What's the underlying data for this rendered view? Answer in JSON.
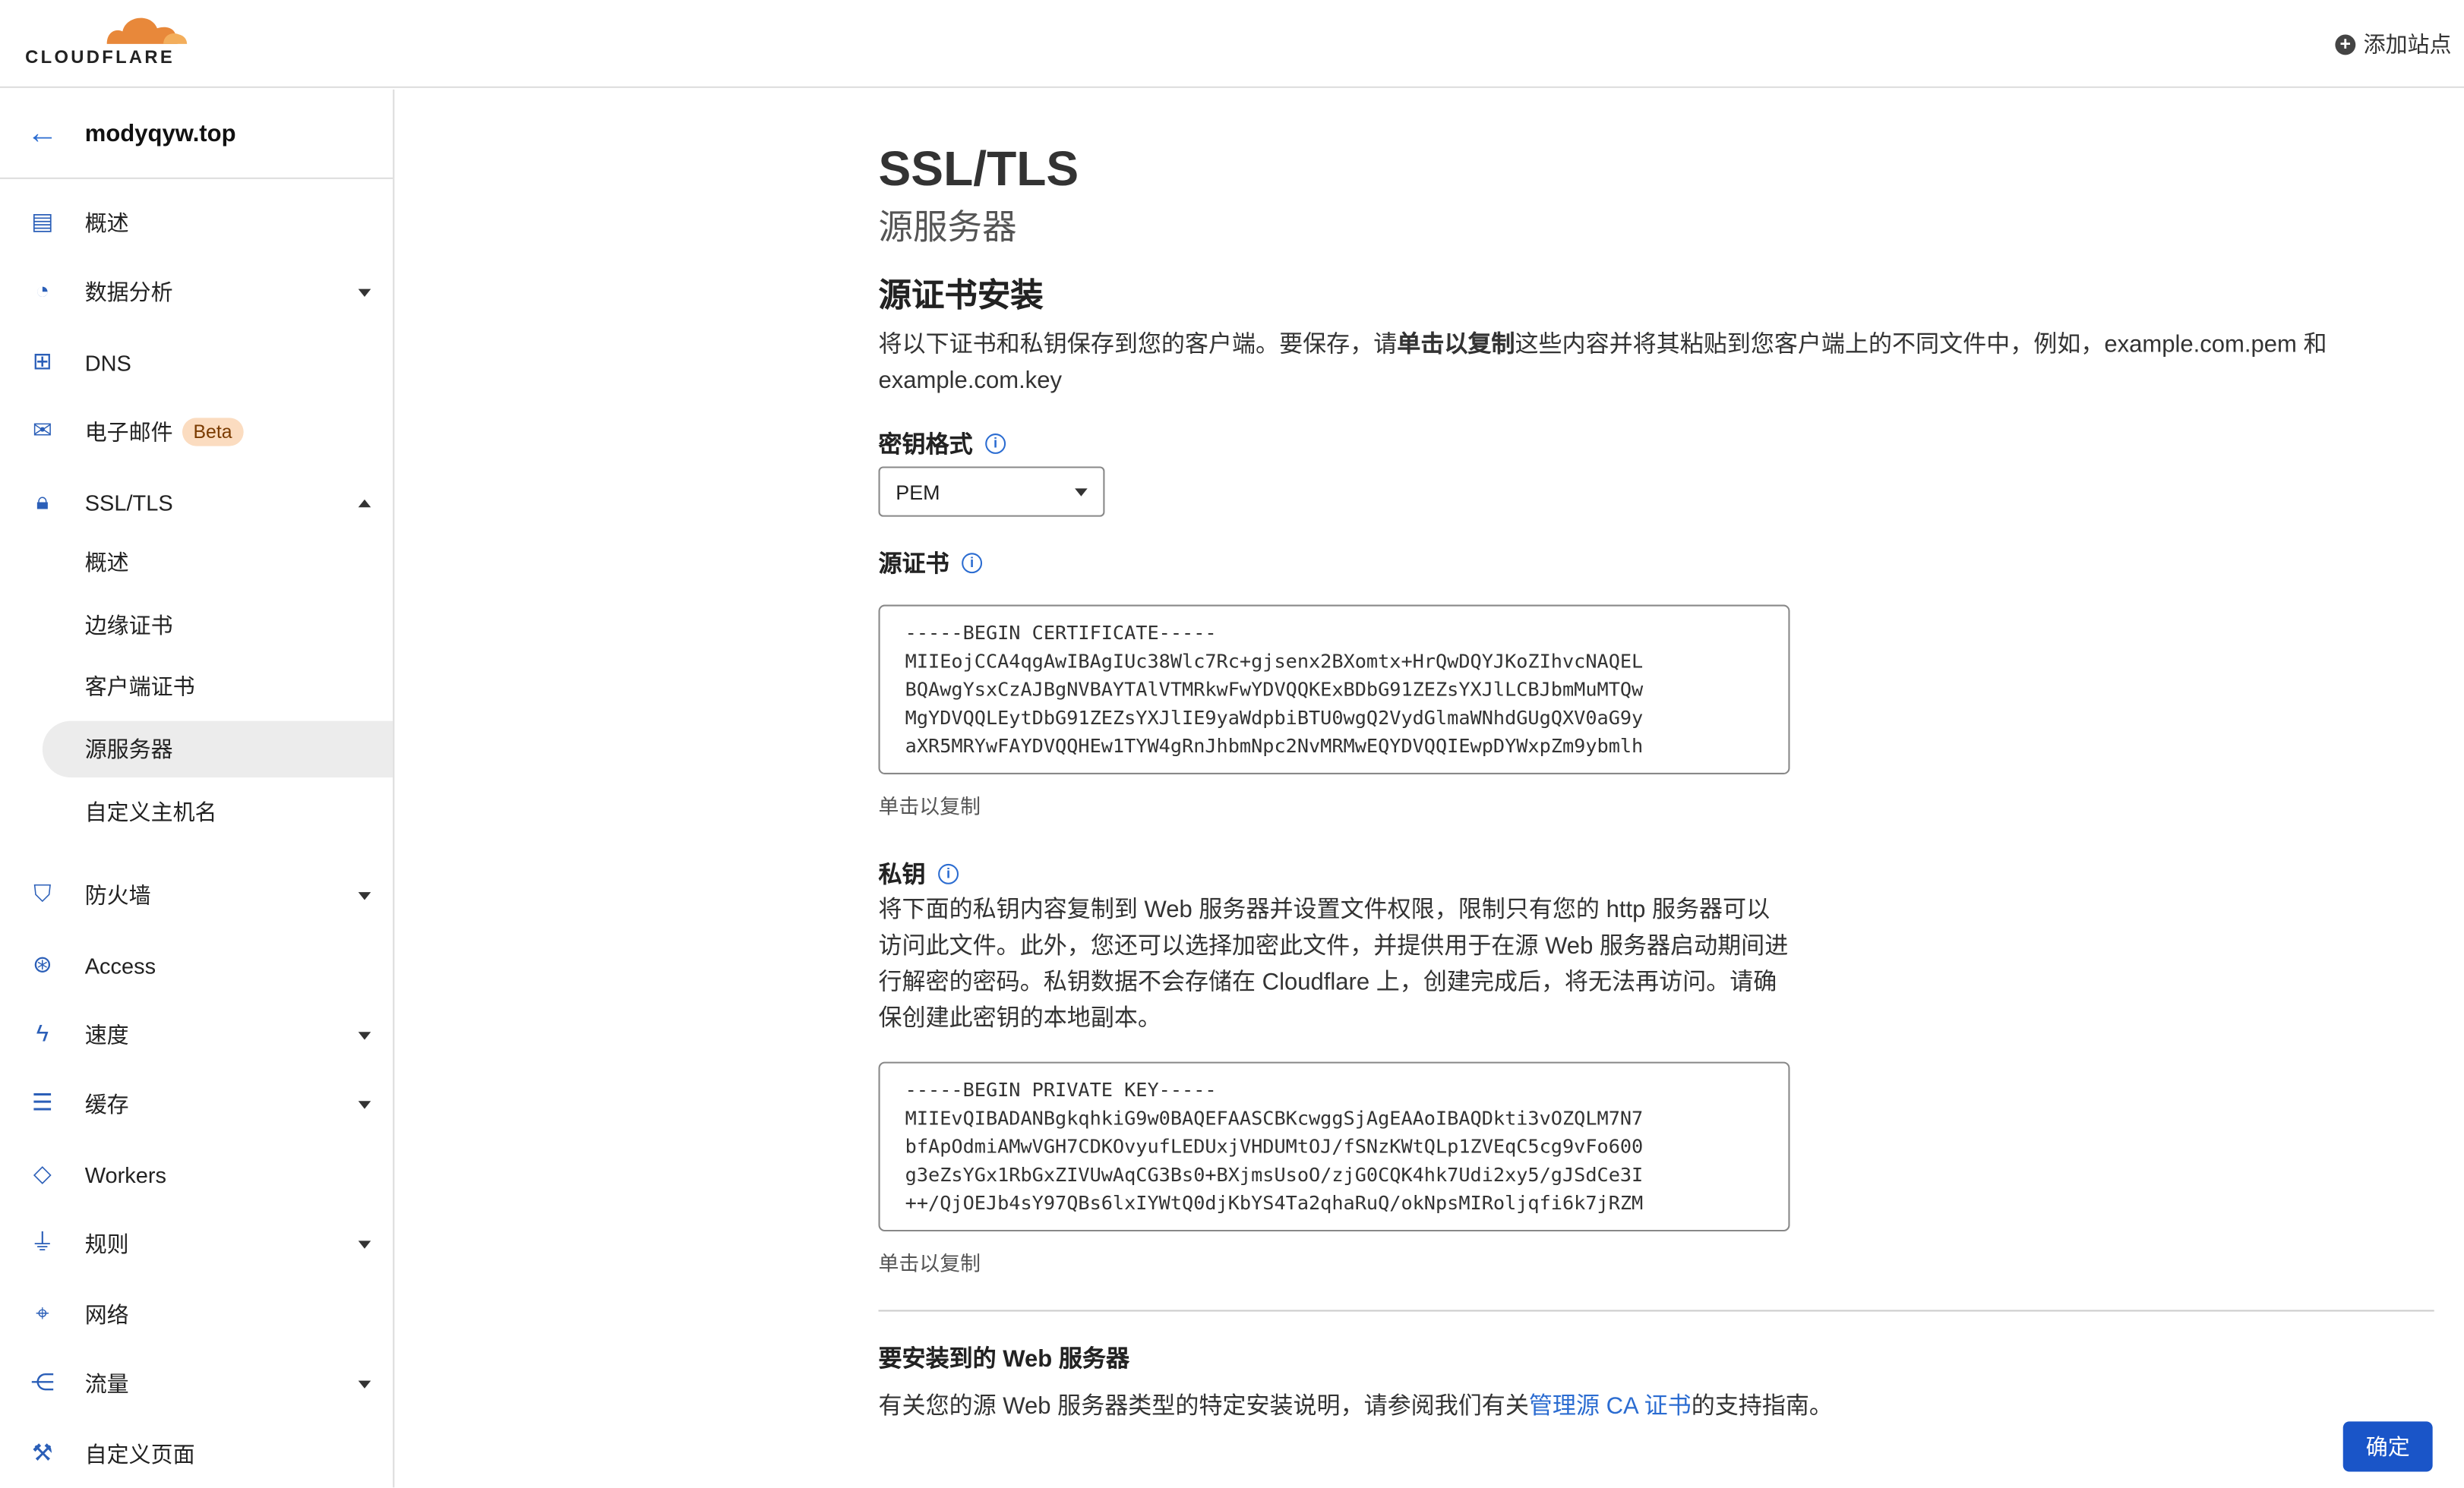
{
  "header": {
    "brand": "CLOUDFLARE",
    "add_site": "添加站点"
  },
  "sidebar": {
    "zone": "modyqyw.top",
    "items": [
      {
        "label": "概述",
        "icon": "clipboard-icon"
      },
      {
        "label": "数据分析",
        "icon": "pie-chart-icon"
      },
      {
        "label": "DNS",
        "icon": "network-icon"
      },
      {
        "label": "电子邮件",
        "icon": "mail-icon",
        "badge": "Beta"
      },
      {
        "label": "SSL/TLS",
        "icon": "lock-icon",
        "expanded": true
      },
      {
        "label": "防火墙",
        "icon": "shield-icon"
      },
      {
        "label": "Access",
        "icon": "access-icon"
      },
      {
        "label": "速度",
        "icon": "lightning-icon"
      },
      {
        "label": "缓存",
        "icon": "storage-icon"
      },
      {
        "label": "Workers",
        "icon": "workers-icon"
      },
      {
        "label": "规则",
        "icon": "filter-icon"
      },
      {
        "label": "网络",
        "icon": "location-pin-icon"
      },
      {
        "label": "流量",
        "icon": "traffic-icon"
      },
      {
        "label": "自定义页面",
        "icon": "wrench-icon"
      }
    ],
    "ssl_sub": [
      "概述",
      "边缘证书",
      "客户端证书",
      "源服务器",
      "自定义主机名"
    ],
    "active_sub": "源服务器"
  },
  "main": {
    "title": "SSL/TLS",
    "subtitle": "源服务器",
    "section": "源证书安装",
    "desc_a": "将以下证书和私钥保存到您的客户端。要保存，请",
    "desc_bold": "单击以复制",
    "desc_b": "这些内容并将其粘贴到您客户端上的不同文件中，例如，example.com.pem 和 example.com.key",
    "key_format_label": "密钥格式",
    "key_format_value": "PEM",
    "cert_label": "源证书",
    "cert_text": "-----BEGIN CERTIFICATE-----\nMIIEojCCA4qgAwIBAgIUc38Wlc7Rc+gjsenx2BXomtx+HrQwDQYJKoZIhvcNAQEL\nBQAwgYsxCzAJBgNVBAYTAlVTMRkwFwYDVQQKExBDbG91ZEZsYXJlLCBJbmMuMTQw\nMgYDVQQLEytDbG91ZEZsYXJlIE9yaWdpbiBTU0wgQ2VydGlmaWNhdGUgQXV0aG9y\naXR5MRYwFAYDVQQHEw1TYW4gRnJhbmNpc2NvMRMwEQYDVQQIEwpDYWxpZm9ybmlh",
    "copy_hint": "单击以复制",
    "key_label": "私钥",
    "key_desc": "将下面的私钥内容复制到 Web 服务器并设置文件权限，限制只有您的 http 服务器可以访问此文件。此外，您还可以选择加密此文件，并提供用于在源 Web 服务器启动期间进行解密的密码。私钥数据不会存储在 Cloudflare 上，创建完成后，将无法再访问。请确保创建此密钥的本地副本。",
    "key_text": "-----BEGIN PRIVATE KEY-----\nMIIEvQIBADANBgkqhkiG9w0BAQEFAASCBKcwggSjAgEAAoIBAQDkti3vOZQLM7N7\nbfApOdmiAMwVGH7CDKOvyufLEDUxjVHDUMtOJ/fSNzKWtQLp1ZVEqC5cg9vFo600\ng3eZsYGx1RbGxZIVUwAqCG3Bs0+BXjmsUsoO/zjG0CQK4hk7Udi2xy5/gJSdCe3I\n++/QjOEJb4sY97QBs6lxIYWtQ0djKbYS4Ta2qhaRuQ/okNpsMIRoljqfi6k7jRZM",
    "key_copy_hint": "单击以复制",
    "server_title": "要安装到的 Web 服务器",
    "server_desc_a": "有关您的源 Web 服务器类型的特定安装说明，请参阅我们有关",
    "server_link": "管理源 CA 证书",
    "server_desc_b": "的支持指南。",
    "ok_button": "确定"
  },
  "colors": {
    "accent": "#1a55c8",
    "link": "#2b6cd1",
    "brand_orange": "#e8883a"
  }
}
